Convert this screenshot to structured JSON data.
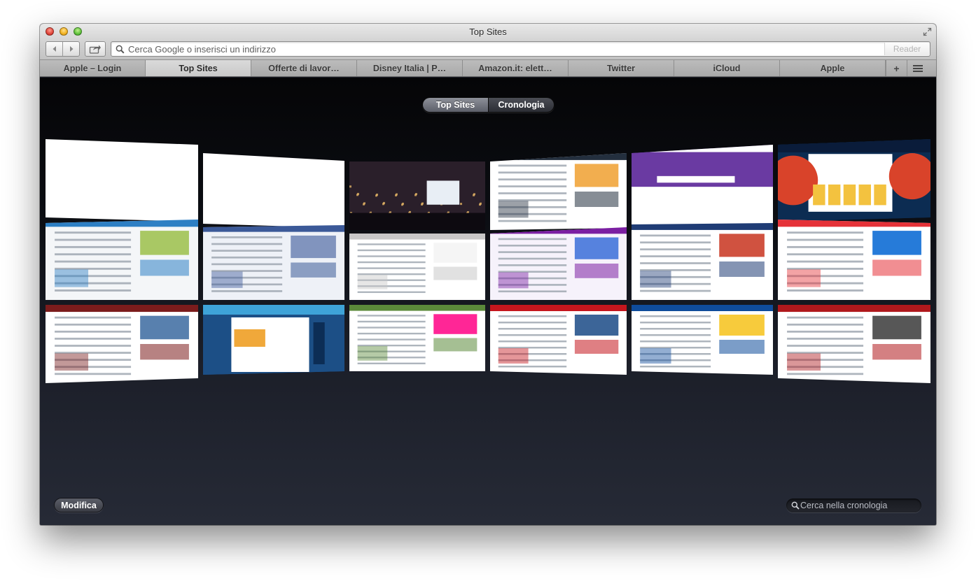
{
  "window": {
    "title": "Top Sites"
  },
  "toolbar": {
    "back_icon": "chevron-left-icon",
    "forward_icon": "chevron-right-icon",
    "share_icon": "share-icon",
    "address_placeholder": "Cerca Google o inserisci un indirizzo",
    "reader_label": "Reader"
  },
  "tabs": [
    {
      "label": "Apple – Login",
      "active": false
    },
    {
      "label": "Top Sites",
      "active": true
    },
    {
      "label": "Offerte di lavor…",
      "active": false
    },
    {
      "label": "Disney Italia | P…",
      "active": false
    },
    {
      "label": "Amazon.it: elett…",
      "active": false
    },
    {
      "label": "Twitter",
      "active": false
    },
    {
      "label": "iCloud",
      "active": false
    },
    {
      "label": "Apple",
      "active": false
    }
  ],
  "tab_controls": {
    "new_tab": "+",
    "tab_list_icon": "list-icon"
  },
  "segmented": {
    "top_sites": "Top Sites",
    "history": "Cronologia",
    "selected": "top_sites"
  },
  "top_sites": [
    {
      "thumb": "blank"
    },
    {
      "thumb": "blank"
    },
    {
      "thumb": "dark-city"
    },
    {
      "thumb": "amazon-like"
    },
    {
      "thumb": "monster-purple"
    },
    {
      "thumb": "disney-brave"
    },
    {
      "thumb": "apple-login-white"
    },
    {
      "thumb": "facebook-login"
    },
    {
      "thumb": "blank-header"
    },
    {
      "thumb": "yahoo-news"
    },
    {
      "thumb": "repubblica"
    },
    {
      "thumb": "ebay-listing"
    },
    {
      "thumb": "corriere"
    },
    {
      "thumb": "immobiliare-blue"
    },
    {
      "thumb": "flickr-landscape"
    },
    {
      "thumb": "news-portal-red"
    },
    {
      "thumb": "expedia"
    },
    {
      "thumb": "sky-news-red"
    }
  ],
  "footer": {
    "edit_label": "Modifica",
    "history_search_placeholder": "Cerca nella cronologia"
  },
  "colors": {
    "content_background": "#1d2029",
    "tab_active": "#d2d2d2",
    "segment_active": "#75787f"
  }
}
